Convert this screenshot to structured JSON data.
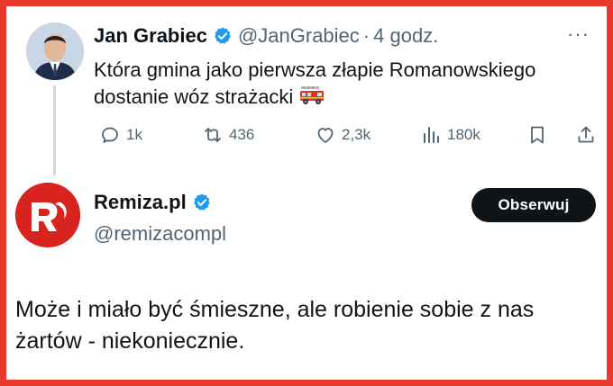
{
  "colors": {
    "frame": "#e8392c",
    "verified": "#1d9bf0",
    "text": "#0f1419",
    "muted": "#536471",
    "follow_bg": "#0f1419"
  },
  "reply_to": {
    "name": "Jan Grabiec",
    "handle": "@JanGrabiec",
    "separator": "·",
    "time": "4 godz.",
    "more": "···",
    "text": "Która gmina jako pierwsza złapie Romanowskiego dostanie wóz strażacki",
    "emoji_icon": "fire-engine-icon",
    "stats": {
      "replies": "1k",
      "reposts": "436",
      "likes": "2,3k",
      "views": "180k"
    }
  },
  "tweet": {
    "name": "Remiza.pl",
    "handle": "@remizacompl",
    "follow_label": "Obserwuj",
    "text": "Może i miało być śmieszne, ale robienie sobie z nas żartów - niekoniecznie."
  }
}
